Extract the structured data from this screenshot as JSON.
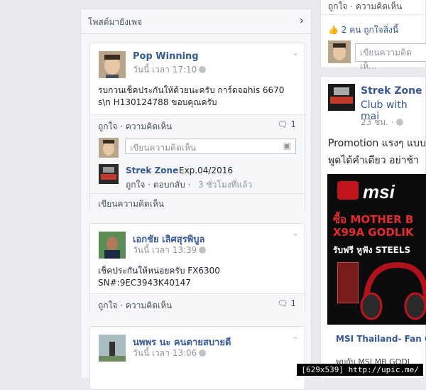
{
  "left_panel": {
    "header_title": "โพสต์มายังเพจ"
  },
  "post1": {
    "author": "Pop Winning",
    "time": "วันนี้ เวลา 17:10",
    "text": "รบกวนเช็คประกันให้ด้วยนะครับ การ์ดจอhis 6670\ns\\n H130124788 ขอบคุณครับ",
    "actions": "ถูกใจ · ความคิดเห็น",
    "comment_count": "1",
    "comment_placeholder": "เขียนความคิดเห็น",
    "reply": {
      "author": "Strek Zone",
      "text": "Exp.04/2016",
      "actions": "ถูกใจ · ตอบกลับ · ",
      "time": "3 ชั่วโมงที่แล้ว"
    },
    "write_comment": "เขียนความคิดเห็น"
  },
  "post2": {
    "author": "เอกชัย เลิศสุรพิบูล",
    "time": "วันนี้ เวลา 13:39",
    "text": "เช็คประกันให้หน่อยครับ FX6300\nSN#:9EC3943K40147",
    "actions": "ถูกใจ · ความคิดเห็น",
    "comment_count": "1"
  },
  "post3": {
    "author": "นพพร นะ คนตายสบายดี",
    "time": "วันนี้ เวลา 13:06"
  },
  "right_panel": {
    "top_actions": "ถูกใจ · ความคิดเห็น",
    "likes": "2 คน ถูกใจสิ่งนี้",
    "comment_placeholder": "เขียนความคิดเห็...",
    "post_author": "Strek Zone",
    "post_sub": "Club with mai",
    "post_time": "23 ชม. ·",
    "post_text_1": "Promotion แรงๆ แบบ",
    "post_text_2": "พูดได้คำเดียว อย่าช้า",
    "ad_brand": "msi",
    "ad_line1": "ซื้อ MOTHER B",
    "ad_line2": "X99A GODLIK",
    "ad_line3": "รับฟรี หูฟัง STEELS",
    "link_title": "MSI Thailand- Fan C",
    "link_sub": "พบกับ MSI MB GODL"
  },
  "watermark": "[629x539] http://upic.me/"
}
